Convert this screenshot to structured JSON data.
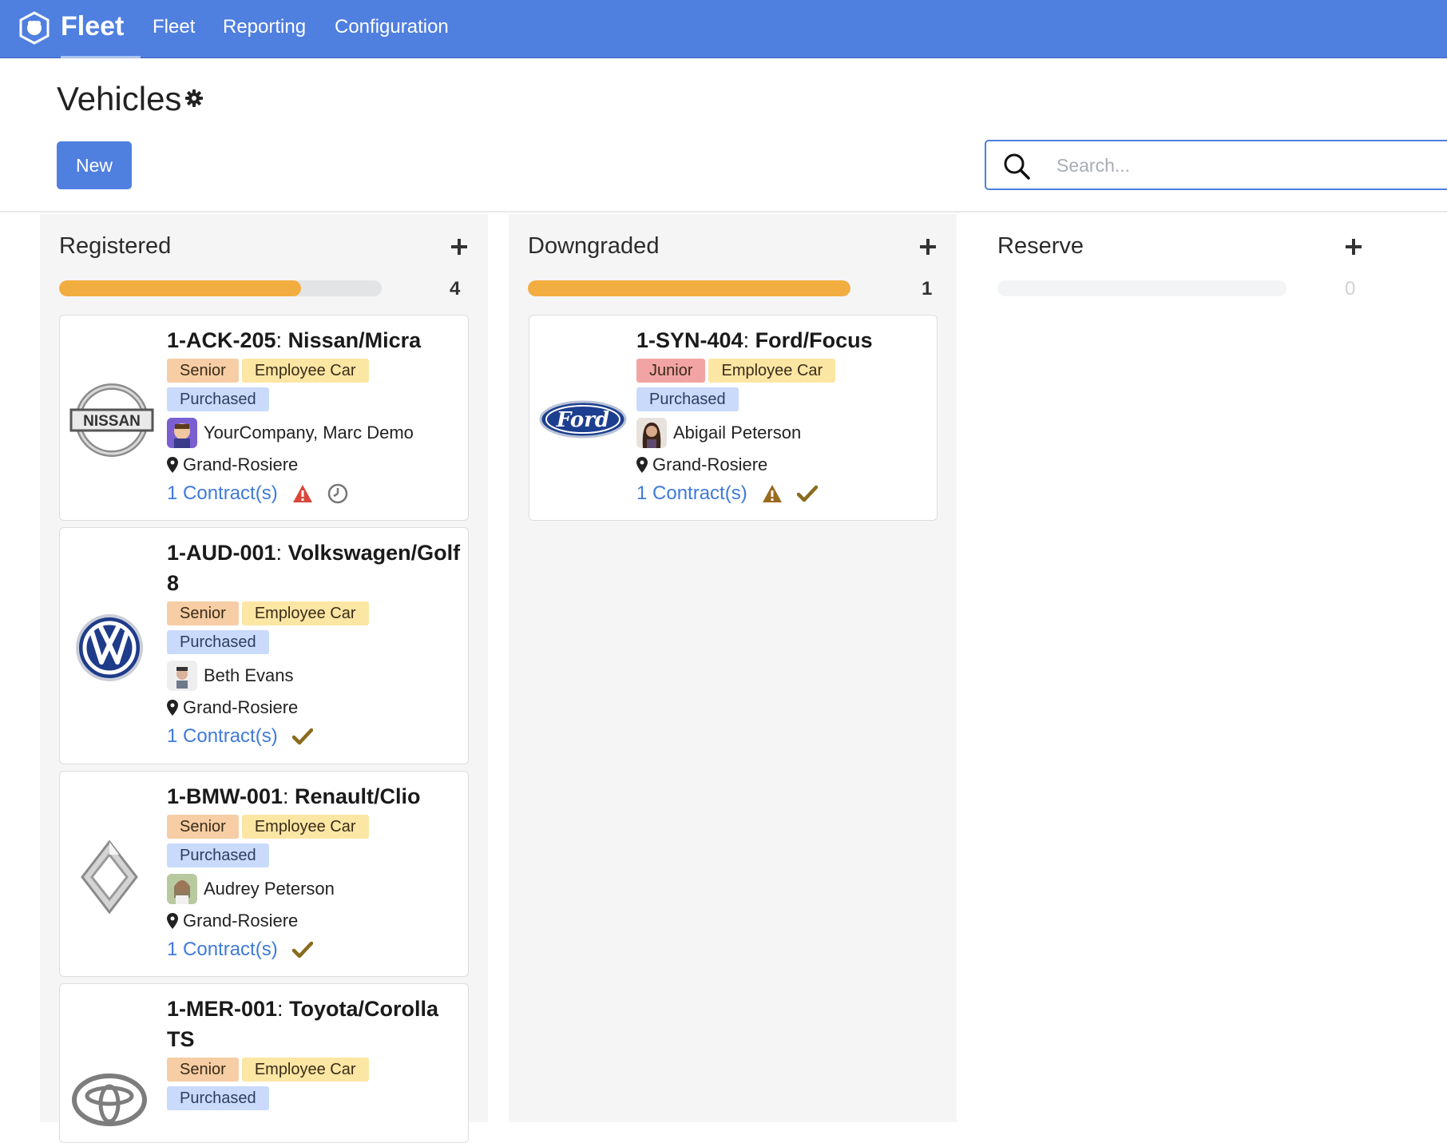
{
  "app": {
    "name": "Fleet"
  },
  "nav": {
    "items": [
      "Fleet",
      "Reporting",
      "Configuration"
    ]
  },
  "page": {
    "title": "Vehicles",
    "new_label": "New",
    "search_placeholder": "Search..."
  },
  "colors": {
    "navbar": "#4f7fdf",
    "progress": "#f2ad40",
    "link": "#3f7ad9",
    "danger": "#d9473a",
    "warning": "#9a6b1f",
    "success": "#8a6b1e"
  },
  "columns": [
    {
      "title": "Registered",
      "count": "4",
      "progress_fraction": 0.75,
      "cards": [
        {
          "plate": "1-ACK-205",
          "model": "Nissan/Micra",
          "tags": [
            "Senior",
            "Employee Car",
            "Purchased"
          ],
          "driver": "YourCompany, Marc Demo",
          "location": "Grand-Rosiere",
          "contracts": "1 Contract(s)",
          "icons": [
            "warning-red",
            "clock"
          ],
          "logo": "nissan"
        },
        {
          "plate": "1-AUD-001",
          "model": "Volkswagen/Golf 8",
          "tags": [
            "Senior",
            "Employee Car",
            "Purchased"
          ],
          "driver": "Beth Evans",
          "location": "Grand-Rosiere",
          "contracts": "1 Contract(s)",
          "icons": [
            "check"
          ],
          "logo": "vw"
        },
        {
          "plate": "1-BMW-001",
          "model": "Renault/Clio",
          "tags": [
            "Senior",
            "Employee Car",
            "Purchased"
          ],
          "driver": "Audrey Peterson",
          "location": "Grand-Rosiere",
          "contracts": "1 Contract(s)",
          "icons": [
            "check"
          ],
          "logo": "renault"
        },
        {
          "plate": "1-MER-001",
          "model": "Toyota/Corolla TS",
          "tags": [
            "Senior",
            "Employee Car",
            "Purchased"
          ],
          "driver": "",
          "location": "",
          "contracts": "",
          "icons": [],
          "logo": "toyota"
        }
      ]
    },
    {
      "title": "Downgraded",
      "count": "1",
      "progress_fraction": 1.0,
      "cards": [
        {
          "plate": "1-SYN-404",
          "model": "Ford/Focus",
          "tags": [
            "Junior",
            "Employee Car",
            "Purchased"
          ],
          "driver": "Abigail Peterson",
          "location": "Grand-Rosiere",
          "contracts": "1 Contract(s)",
          "icons": [
            "warning-brown",
            "check"
          ],
          "logo": "ford"
        }
      ]
    },
    {
      "title": "Reserve",
      "count": "0",
      "progress_fraction": 0,
      "cards": []
    }
  ]
}
